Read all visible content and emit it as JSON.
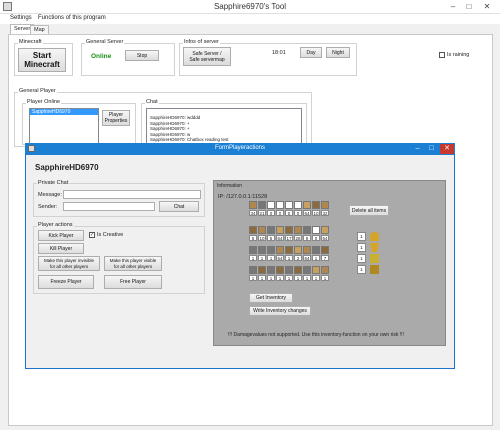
{
  "window": {
    "title": "Sapphire6970's Tool",
    "minimize": "–",
    "maximize": "□",
    "close": "✕"
  },
  "menu": {
    "items": [
      "Settings",
      "Functions of this program"
    ]
  },
  "tabs": [
    "Server",
    "Map"
  ],
  "minecraft": {
    "group": "Minecraft",
    "start_button": "Start\nMinecraft"
  },
  "general_server": {
    "group": "General Server",
    "status": "Online",
    "status_color": "#1a8f1a",
    "stop_button": "Stop"
  },
  "info_server": {
    "group": "Infos of server",
    "safe_button": "Safe Server /\nSafe servermap",
    "time": "18:01",
    "day_button": "Day",
    "night_button": "Night",
    "raining_label": "Is raining",
    "raining_checked": false
  },
  "general_player": {
    "group": "General Player",
    "players_online_group": "Player Online",
    "players": [
      "SapphireHD6970"
    ],
    "properties_button": "Player\nProperties",
    "chat_group": "Chat",
    "chat_lines": [
      "SapphireHD6970: wdddd",
      "SapphireHD6970: +",
      "SapphireHD6970: +",
      "SapphireHD6970: w",
      "SapphireHD6970: Chatbox reading test"
    ]
  },
  "player_form": {
    "title": "FormPlayeractions",
    "player_name": "SapphireHD6970",
    "private_chat": {
      "group": "Private Chat",
      "message_label": "Message:",
      "sender_label": "Sender:",
      "message_value": "",
      "sender_value": "",
      "chat_button": "Chat"
    },
    "actions": {
      "group": "Player actions",
      "kick_button": "Kick Player",
      "creative_label": "Is Creative",
      "creative_checked": true,
      "kill_button": "Kill Player",
      "invisible_button": "Make this player invisible\nfor all other players",
      "visible_button": "Make this player visible\nfor all other players",
      "freeze_button": "Freeze Player",
      "free_button": "Free Player"
    },
    "information": {
      "group": "Information",
      "ip": "IP: /127.0.0.1:11528",
      "hotbar_counts": [
        "34",
        "21",
        "0",
        "0",
        "0",
        "0",
        "64",
        "10",
        "32"
      ],
      "row2_counts": [
        "5",
        "10",
        "5",
        "64",
        "17",
        "28",
        "9",
        "0",
        "64"
      ],
      "row3_counts": [
        "1",
        "1",
        "1",
        "64",
        "1",
        "2",
        "64",
        "1",
        "7"
      ],
      "row4_counts": [
        "1",
        "1",
        "1",
        "1",
        "1",
        "1",
        "1",
        "1",
        "1"
      ],
      "delete_all_button": "Delete all items",
      "armor_counts": [
        "1",
        "1",
        "1",
        "1"
      ],
      "get_inventory_button": "Get Inventory",
      "write_inventory_button": "Write Inventory changes",
      "warning": "!!! Damagevalues not supported. Use this inventory-function on your own risk !!!"
    }
  }
}
